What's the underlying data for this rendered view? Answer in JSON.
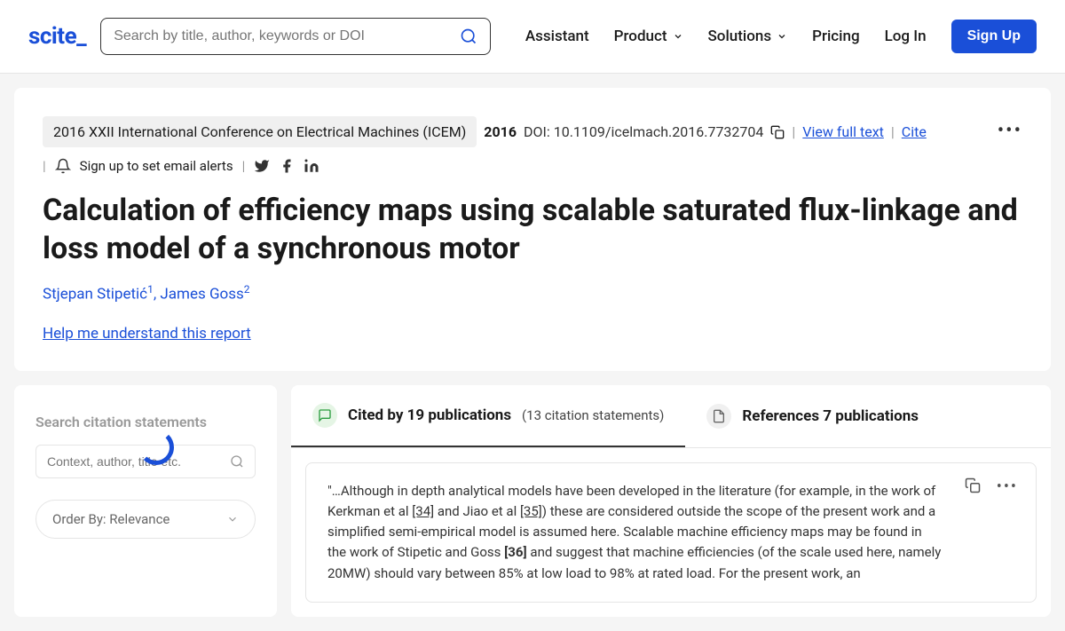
{
  "header": {
    "logo": "scite_",
    "search_placeholder": "Search by title, author, keywords or DOI",
    "nav": {
      "assistant": "Assistant",
      "product": "Product",
      "solutions": "Solutions",
      "pricing": "Pricing",
      "login": "Log In",
      "signup": "Sign Up"
    }
  },
  "paper": {
    "conference": "2016 XXII International Conference on Electrical Machines (ICEM)",
    "year": "2016",
    "doi_label": "DOI: 10.1109/icelmach.2016.7732704",
    "view_full": "View full text",
    "cite": "Cite",
    "email_alert": "Sign up to set email alerts",
    "title": "Calculation of efficiency maps using scalable saturated flux-linkage and loss model of a synchronous motor",
    "author1": "Stjepan Stipetić",
    "author1_sup": "1",
    "author2": "James Goss",
    "author2_sup": "2",
    "help": "Help me understand this report"
  },
  "sidebar": {
    "title": "Search citation statements",
    "search_placeholder": "Context, author, title etc.",
    "orderby": "Order By: Relevance"
  },
  "tabs": {
    "cited_main": "Cited by 19 publications",
    "cited_sub": "(13 citation statements)",
    "refs": "References 7 publications"
  },
  "citation": {
    "text1": "\"…Although in depth analytical models have been developed in the literature (for example, in the work of Kerkman et al ",
    "ref34": "[34]",
    "text2": " and Jiao et al ",
    "ref35": "[35]",
    "text3": ") these are considered outside the scope of the present work and a simplified semi-empirical model is assumed here. Scalable machine efficiency maps may be found in the work of Stipetic and Goss ",
    "ref36": "[36]",
    "text4": " and suggest that machine efficiencies (of the scale used here, namely 20MW) should vary between 85% at low load to 98% at rated load. For the present work, an"
  }
}
